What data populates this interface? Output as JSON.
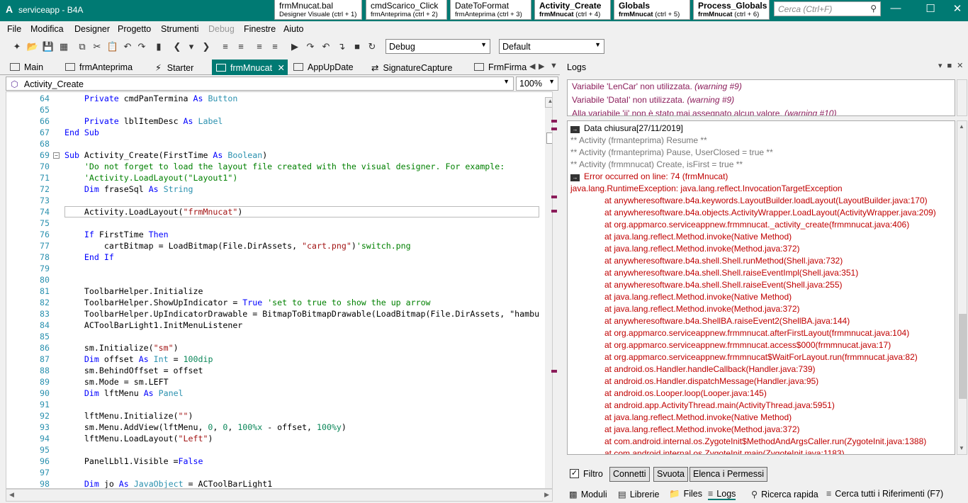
{
  "window": {
    "title": "serviceapp - B4A",
    "app_icon": "b4a-logo",
    "search_placeholder": "Cerca (Ctrl+F)"
  },
  "quick_tabs": [
    {
      "title": "frmMnucat.bal",
      "sub": "Designer Visuale  (ctrl + 1)"
    },
    {
      "title": "cmdScarico_Click",
      "sub": "frmAnteprima  (ctrl + 2)"
    },
    {
      "title": "DateToFormat",
      "sub": "frmAnteprima  (ctrl + 3)"
    },
    {
      "title": "Activity_Create",
      "sub_bold": "frmMnucat",
      "sub": "(ctrl + 4)"
    },
    {
      "title": "Globals",
      "sub_bold": "frmMnucat",
      "sub": "(ctrl + 5)"
    },
    {
      "title": "Process_Globals",
      "sub_bold": "frmMnucat",
      "sub": "(ctrl + 6)"
    }
  ],
  "menu": [
    "File",
    "Modifica",
    "Designer",
    "Progetto",
    "Strumenti",
    "Debug",
    "Finestre",
    "Aiuto"
  ],
  "toolbar": {
    "build_mode": "Debug",
    "build_config": "Default"
  },
  "editor_tabs": [
    "Main",
    "frmAnteprima",
    "Starter",
    "frmMnucat",
    "AppUpDate",
    "SignatureCapture",
    "FrmFirma"
  ],
  "sub_selector": "Activity_Create",
  "zoom": "100%",
  "code_lines": [
    {
      "n": "64",
      "t": "    Private cmdPanTermina As Button"
    },
    {
      "n": "65",
      "t": ""
    },
    {
      "n": "66",
      "t": "    Private lblItemDesc As Label"
    },
    {
      "n": "67",
      "t": "End Sub"
    },
    {
      "n": "68",
      "t": ""
    },
    {
      "n": "69",
      "t": "Sub Activity_Create(FirstTime As Boolean)"
    },
    {
      "n": "70",
      "t": "    'Do not forget to load the layout file created with the visual designer. For example:"
    },
    {
      "n": "71",
      "t": "    'Activity.LoadLayout(\"Layout1\")"
    },
    {
      "n": "72",
      "t": "    Dim fraseSql As String"
    },
    {
      "n": "73",
      "t": ""
    },
    {
      "n": "74",
      "t": "    Activity.LoadLayout(\"frmMnucat\")"
    },
    {
      "n": "75",
      "t": ""
    },
    {
      "n": "76",
      "t": "    If FirstTime Then"
    },
    {
      "n": "77",
      "t": "        cartBitmap = LoadBitmap(File.DirAssets, \"cart.png\")'switch.png"
    },
    {
      "n": "78",
      "t": "    End If"
    },
    {
      "n": "79",
      "t": ""
    },
    {
      "n": "80",
      "t": ""
    },
    {
      "n": "81",
      "t": "    ToolbarHelper.Initialize"
    },
    {
      "n": "82",
      "t": "    ToolbarHelper.ShowUpIndicator = True 'set to true to show the up arrow"
    },
    {
      "n": "83",
      "t": "    ToolbarHelper.UpIndicatorDrawable = BitmapToBitmapDrawable(LoadBitmap(File.DirAssets, \"hambu"
    },
    {
      "n": "84",
      "t": "    ACToolBarLight1.InitMenuListener"
    },
    {
      "n": "85",
      "t": ""
    },
    {
      "n": "86",
      "t": "    sm.Initialize(\"sm\")"
    },
    {
      "n": "87",
      "t": "    Dim offset As Int = 100dip"
    },
    {
      "n": "88",
      "t": "    sm.BehindOffset = offset"
    },
    {
      "n": "89",
      "t": "    sm.Mode = sm.LEFT"
    },
    {
      "n": "90",
      "t": "    Dim lftMenu As Panel"
    },
    {
      "n": "91",
      "t": ""
    },
    {
      "n": "92",
      "t": "    lftMenu.Initialize(\"\")"
    },
    {
      "n": "93",
      "t": "    sm.Menu.AddView(lftMenu, 0, 0, 100%x - offset, 100%y)"
    },
    {
      "n": "94",
      "t": "    lftMenu.LoadLayout(\"Left\")"
    },
    {
      "n": "95",
      "t": ""
    },
    {
      "n": "96",
      "t": "    PanelLbl1.Visible =False"
    },
    {
      "n": "97",
      "t": ""
    },
    {
      "n": "98",
      "t": "    Dim jo As JavaObject = ACToolBarLight1"
    }
  ],
  "logs": {
    "title": "Logs",
    "warnings": [
      {
        "text": "Variabile 'LenCar' non utilizzata.",
        "tag": "(warning #9)"
      },
      {
        "text": "Variabile 'DataI' non utilizzata.",
        "tag": "(warning #9)"
      },
      {
        "text": "Alla variabile 'ii' non è stato mai assegnato alcun valore.",
        "tag": "(warning #10)"
      }
    ],
    "entries": [
      {
        "text": "Data chiusura[27/11/2019]",
        "kind": "badge"
      },
      {
        "text": "** Activity (frmanteprima) Resume **",
        "kind": "gray"
      },
      {
        "text": "** Activity (frmanteprima) Pause, UserClosed = true **",
        "kind": "gray"
      },
      {
        "text": "** Activity (frmmnucat) Create, isFirst = true **",
        "kind": "gray"
      },
      {
        "text": "Error occurred on line: 74 (frmMnucat)",
        "kind": "badge-red"
      },
      {
        "text": "java.lang.RuntimeException: java.lang.reflect.InvocationTargetException",
        "kind": "red"
      },
      {
        "text": "at anywheresoftware.b4a.keywords.LayoutBuilder.loadLayout(LayoutBuilder.java:170)",
        "kind": "trace"
      },
      {
        "text": "at anywheresoftware.b4a.objects.ActivityWrapper.LoadLayout(ActivityWrapper.java:209)",
        "kind": "trace"
      },
      {
        "text": "at org.appmarco.serviceappnew.frmmnucat._activity_create(frmmnucat.java:406)",
        "kind": "trace"
      },
      {
        "text": "at java.lang.reflect.Method.invoke(Native Method)",
        "kind": "trace"
      },
      {
        "text": "at java.lang.reflect.Method.invoke(Method.java:372)",
        "kind": "trace"
      },
      {
        "text": "at anywheresoftware.b4a.shell.Shell.runMethod(Shell.java:732)",
        "kind": "trace"
      },
      {
        "text": "at anywheresoftware.b4a.shell.Shell.raiseEventImpl(Shell.java:351)",
        "kind": "trace"
      },
      {
        "text": "at anywheresoftware.b4a.shell.Shell.raiseEvent(Shell.java:255)",
        "kind": "trace"
      },
      {
        "text": "at java.lang.reflect.Method.invoke(Native Method)",
        "kind": "trace"
      },
      {
        "text": "at java.lang.reflect.Method.invoke(Method.java:372)",
        "kind": "trace"
      },
      {
        "text": "at anywheresoftware.b4a.ShellBA.raiseEvent2(ShellBA.java:144)",
        "kind": "trace"
      },
      {
        "text": "at org.appmarco.serviceappnew.frmmnucat.afterFirstLayout(frmmnucat.java:104)",
        "kind": "trace"
      },
      {
        "text": "at org.appmarco.serviceappnew.frmmnucat.access$000(frmmnucat.java:17)",
        "kind": "trace"
      },
      {
        "text": "at org.appmarco.serviceappnew.frmmnucat$WaitForLayout.run(frmmnucat.java:82)",
        "kind": "trace"
      },
      {
        "text": "at android.os.Handler.handleCallback(Handler.java:739)",
        "kind": "trace"
      },
      {
        "text": "at android.os.Handler.dispatchMessage(Handler.java:95)",
        "kind": "trace"
      },
      {
        "text": "at android.os.Looper.loop(Looper.java:145)",
        "kind": "trace"
      },
      {
        "text": "at android.app.ActivityThread.main(ActivityThread.java:5951)",
        "kind": "trace"
      },
      {
        "text": "at java.lang.reflect.Method.invoke(Native Method)",
        "kind": "trace"
      },
      {
        "text": "at java.lang.reflect.Method.invoke(Method.java:372)",
        "kind": "trace"
      },
      {
        "text": "at com.android.internal.os.ZygoteInit$MethodAndArgsCaller.run(ZygoteInit.java:1388)",
        "kind": "trace"
      },
      {
        "text": "at com.android.internal.os.ZygoteInit.main(ZygoteInit.java:1183)",
        "kind": "trace"
      }
    ],
    "filter_label": "Filtro",
    "filter_checked": true,
    "buttons": [
      "Connetti",
      "Svuota",
      "Elenca i Permessi"
    ]
  },
  "bottom_tabs": [
    {
      "label": "Moduli",
      "icon": "modules-icon"
    },
    {
      "label": "Librerie",
      "icon": "libraries-icon"
    },
    {
      "label": "Files",
      "icon": "folder-icon"
    },
    {
      "label": "Logs",
      "icon": "logs-icon"
    },
    {
      "label": "Ricerca rapida",
      "icon": "search-icon"
    },
    {
      "label": "Cerca tutti i Riferimenti (F7)",
      "icon": "references-icon"
    }
  ],
  "colors": {
    "accent": "#007a73",
    "keyword": "#0000ff",
    "comment": "#008000",
    "string": "#a31515",
    "error": "#c00000",
    "warning": "#8b1c5a"
  }
}
